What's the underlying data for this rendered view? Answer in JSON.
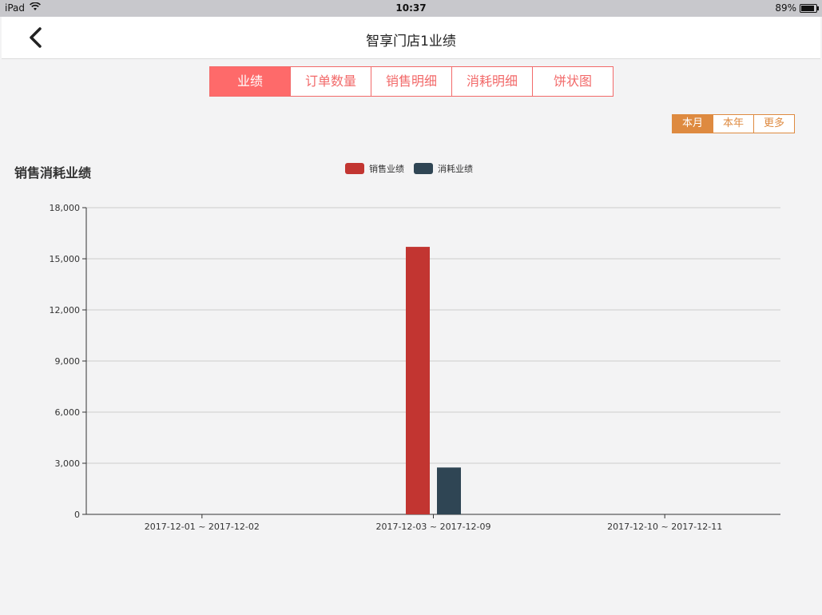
{
  "status_bar": {
    "device": "iPad",
    "time": "10:37",
    "battery": "89%"
  },
  "nav": {
    "title": "智享门店1业绩"
  },
  "tabs": [
    {
      "label": "业绩",
      "active": true
    },
    {
      "label": "订单数量",
      "active": false
    },
    {
      "label": "销售明细",
      "active": false
    },
    {
      "label": "消耗明细",
      "active": false
    },
    {
      "label": "饼状图",
      "active": false
    }
  ],
  "period": [
    {
      "label": "本月",
      "active": true
    },
    {
      "label": "本年",
      "active": false
    },
    {
      "label": "更多",
      "active": false
    }
  ],
  "colors": {
    "tab_accent": "#fe6a6a",
    "period_accent": "#de8a40",
    "sales": "#c23531",
    "consumption": "#2f4554"
  },
  "chart_data": {
    "type": "bar",
    "title": "销售消耗业绩",
    "categories": [
      "2017-12-01 ~ 2017-12-02",
      "2017-12-03 ~ 2017-12-09",
      "2017-12-10 ~ 2017-12-11"
    ],
    "series": [
      {
        "name": "销售业绩",
        "values": [
          0,
          15700,
          0
        ]
      },
      {
        "name": "消耗业绩",
        "values": [
          0,
          2750,
          0
        ]
      }
    ],
    "ylim": [
      0,
      18000
    ],
    "yticks": [
      "0",
      "3,000",
      "6,000",
      "9,000",
      "12,000",
      "15,000",
      "18,000"
    ],
    "grid": true,
    "legend": "top-center"
  }
}
